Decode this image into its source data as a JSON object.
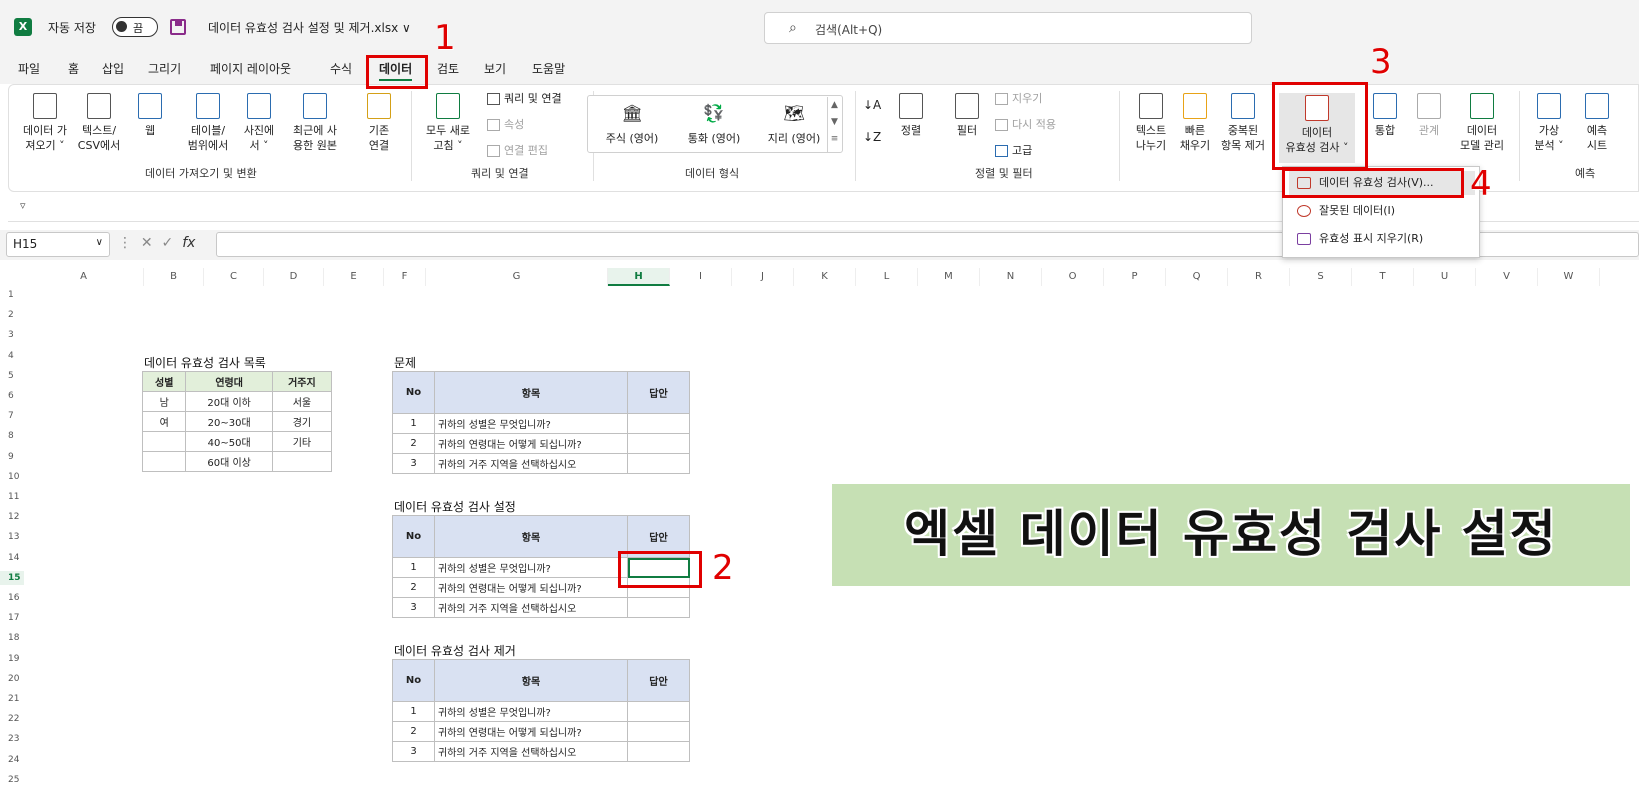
{
  "titlebar": {
    "logo": "X",
    "autosave_label": "자동 저장",
    "autosave_state": "끔",
    "filename": "데이터 유효성 검사 설정 및 제거.xlsx",
    "filename_chevron": "∨",
    "search_placeholder": "검색(Alt+Q)"
  },
  "menu": {
    "items": [
      "파일",
      "홈",
      "삽입",
      "그리기",
      "페이지 레이아웃",
      "수식",
      "데이터",
      "검토",
      "보기",
      "도움말"
    ],
    "active": "데이터"
  },
  "ribbon": {
    "get_data": {
      "line1": "데이터 가",
      "line2": "져오기 ˅"
    },
    "text_csv": {
      "line1": "텍스트/",
      "line2": "CSV에서"
    },
    "web": {
      "line1": "웹"
    },
    "table_range": {
      "line1": "테이블/",
      "line2": "범위에서"
    },
    "from_picture": {
      "line1": "사진에",
      "line2": "서 ˅"
    },
    "recent_sources": {
      "line1": "최근에 사",
      "line2": "용한 원본"
    },
    "existing_conn": {
      "line1": "기존",
      "line2": "연결"
    },
    "group_get": "데이터 가져오기 및 변환",
    "refresh_all": {
      "line1": "모두 새로",
      "line2": "고침 ˅"
    },
    "queries_conn": "쿼리 및 연결",
    "properties": "속성",
    "edit_links": "연결 편집",
    "group_queries": "쿼리 및 연결",
    "stocks": "주식 (영어)",
    "currency": "통화 (영어)",
    "geography": "지리 (영어)",
    "group_datatypes": "데이터 형식",
    "sort": "정렬",
    "filter": "필터",
    "clear": "지우기",
    "reapply": "다시 적용",
    "advanced": "고급",
    "group_sort": "정렬 및 필터",
    "text_to_cols": {
      "line1": "텍스트",
      "line2": "나누기"
    },
    "flash_fill": {
      "line1": "빠른",
      "line2": "채우기"
    },
    "remove_dup": {
      "line1": "중복된",
      "line2": "항목 제거"
    },
    "data_validation": {
      "line1": "데이터",
      "line2": "유효성 검사 ˅"
    },
    "consolidate": "통합",
    "relationships": "관계",
    "data_model": {
      "line1": "데이터",
      "line2": "모델 관리"
    },
    "what_if": {
      "line1": "가상",
      "line2": "분석 ˅"
    },
    "forecast_sheet": {
      "line1": "예측",
      "line2": "시트"
    },
    "group_forecast": "예측"
  },
  "dropdown": {
    "items": [
      "데이터 유효성 검사(V)...",
      "잘못된 데이터(I)",
      "유효성 표시 지우기(R)"
    ]
  },
  "formula": {
    "namebox": "H15",
    "fx": "fx"
  },
  "grid": {
    "columns": [
      "A",
      "B",
      "C",
      "D",
      "E",
      "F",
      "G",
      "H",
      "I",
      "J",
      "K",
      "L",
      "M",
      "N",
      "O",
      "P",
      "Q",
      "R",
      "S",
      "T",
      "U",
      "V",
      "W"
    ],
    "rows": [
      "1",
      "2",
      "3",
      "4",
      "5",
      "6",
      "7",
      "8",
      "9",
      "10",
      "11",
      "12",
      "13",
      "14",
      "15",
      "16",
      "17",
      "18",
      "19",
      "20",
      "21",
      "22",
      "23",
      "24",
      "25"
    ],
    "selected_col": "H",
    "selected_row": "15"
  },
  "list": {
    "title": "데이터 유효성 검사 목록",
    "headers": [
      "성별",
      "연령대",
      "거주지"
    ],
    "rows": [
      [
        "남",
        "20대 이하",
        "서울"
      ],
      [
        "여",
        "20~30대",
        "경기"
      ],
      [
        "",
        "40~50대",
        "기타"
      ],
      [
        "",
        "60대 이상",
        ""
      ]
    ]
  },
  "sections": [
    {
      "title": "문제",
      "headers": [
        "No",
        "항목",
        "답안"
      ],
      "rows": [
        [
          "1",
          "귀하의 성별은 무엇입니까?",
          ""
        ],
        [
          "2",
          "귀하의 연령대는 어떻게 되십니까?",
          ""
        ],
        [
          "3",
          "귀하의 거주 지역을 선택하십시오",
          ""
        ]
      ]
    },
    {
      "title": "데이터 유효성 검사 설정",
      "headers": [
        "No",
        "항목",
        "답안"
      ],
      "rows": [
        [
          "1",
          "귀하의 성별은 무엇입니까?",
          ""
        ],
        [
          "2",
          "귀하의 연령대는 어떻게 되십니까?",
          ""
        ],
        [
          "3",
          "귀하의 거주 지역을 선택하십시오",
          ""
        ]
      ]
    },
    {
      "title": "데이터 유효성 검사 제거",
      "headers": [
        "No",
        "항목",
        "답안"
      ],
      "rows": [
        [
          "1",
          "귀하의 성별은 무엇입니까?",
          ""
        ],
        [
          "2",
          "귀하의 연령대는 어떻게 되십니까?",
          ""
        ],
        [
          "3",
          "귀하의 거주 지역을 선택하십시오",
          ""
        ]
      ]
    }
  ],
  "banner": "엑셀 데이터 유효성 검사 설정",
  "steps": [
    "1",
    "2",
    "3",
    "4"
  ],
  "colors": {
    "excel_green": "#107c41",
    "annotation_red": "#e00000",
    "header_blue": "#d9e1f2",
    "banner_green": "#c6e0b4"
  }
}
